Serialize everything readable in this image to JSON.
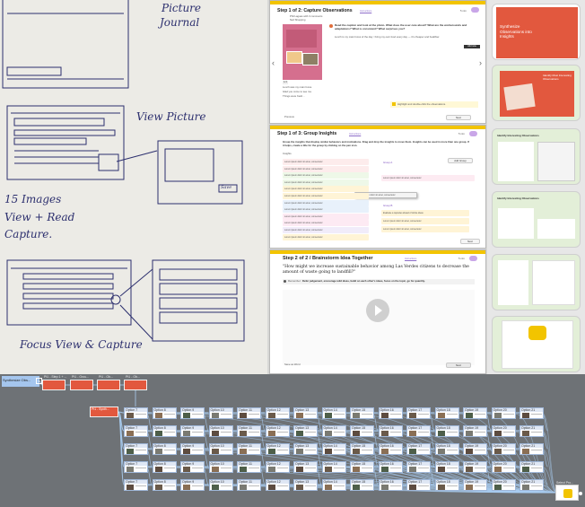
{
  "sketch": {
    "labels": [
      "Picture",
      "Journal",
      "View Picture",
      "15 Images",
      "View + Read",
      "Capture.",
      "Focus View & Capture"
    ],
    "save_box": "Save"
  },
  "screen1": {
    "title": "Step 1 of 2: Capture Observations",
    "instructions": "Instructions",
    "timer": "5 min",
    "author": "Phil Lagoas with 3 comments",
    "location": "Neil Shopping",
    "prompt": "Read the caption and look at the photo. What does the user care about? What are the workarounds and adaptations? What is consistent? What surprises you?",
    "caption": "Lunch is my main focus of the day. I bring my own food every day — it's cheaper and healthier.",
    "photo_caption_lines": [
      "Lunch was my main focus.",
      "Glad you come to see me.",
      "Things were fresh..."
    ],
    "tip": "Highlight and double-click the observations.",
    "page_indicator": "1/4",
    "next": "Next",
    "prev_label": "Previous",
    "chip": "Add note",
    "arrow_left": "‹",
    "arrow_right": "›"
  },
  "screen2": {
    "title": "Step 1 of 3: Group Insights",
    "instructions": "Instructions",
    "timer": "5 min",
    "prompt": "Group the insights that display similar behaviors and motivations. Drag and drop the insights to move them. Insights can be used in more than one group. If it helps, create a title for the group by clicking on the pen icon.",
    "insights_header": "Insights",
    "add_group": "Add Group",
    "insight_text": "Lorem ipsum dolor sit amet, consectetur",
    "group_a": "Group A",
    "group_b": "Group B",
    "dragging": "Lorem ipsum dolor sit amet, consectetur",
    "group_b_items": [
      "Evaluate a capsules ahead of whole ideas",
      "Lorem ipsum dolor sit amet, consectetur",
      "Lorem ipsum dolor sit amet, consectetur"
    ],
    "next": "Next"
  },
  "screen3": {
    "title": "Step 2 of 2 / Brainstorm Idea Together",
    "instructions": "Instructions",
    "timer": "5 min",
    "question": "\"How might we increase sustainable behavior among Las Verdes citizens to decrease the amount of waste going to landfill?\"",
    "reminder_label": "Remember:",
    "reminder": "Defer judgement, encourage wild ideas, build on each other's ideas, focus on the topic, go for quantity.",
    "footer_left": "Save as Word",
    "next": "Next"
  },
  "slides": {
    "slide1_title": "Synthesize Observations into Insights",
    "slide2_title": "Identify Most Interesting Observations",
    "slide3_title": "Identify Interesting Observations",
    "slide4_title": "Identify Interesting Observations"
  },
  "board": {
    "root_label": "Synthesize Obs...",
    "root_badge": "4",
    "top_nodes": [
      "Pt1 - Step 1 + ...",
      "Pt1 - Grou...",
      "Pt1 - Ob...",
      "Pt1 - Ob..."
    ],
    "mid_node": "Pt1 - Synth...",
    "end_label": "Select Pro...",
    "option_labels": [
      "Option 7",
      "Option 8",
      "Option 9",
      "Option 10",
      "Option 11",
      "Option 12",
      "Option 13",
      "Option 14",
      "Option 15",
      "Option 16",
      "Option 17",
      "Option 18",
      "Option 19",
      "Option 20",
      "Option 21"
    ]
  },
  "colors": {
    "accent": "#f2c400",
    "orange": "#e2583e",
    "link": "#8d6dc9",
    "connector": "#a9cdf2",
    "board_bg": "#6e7276"
  }
}
